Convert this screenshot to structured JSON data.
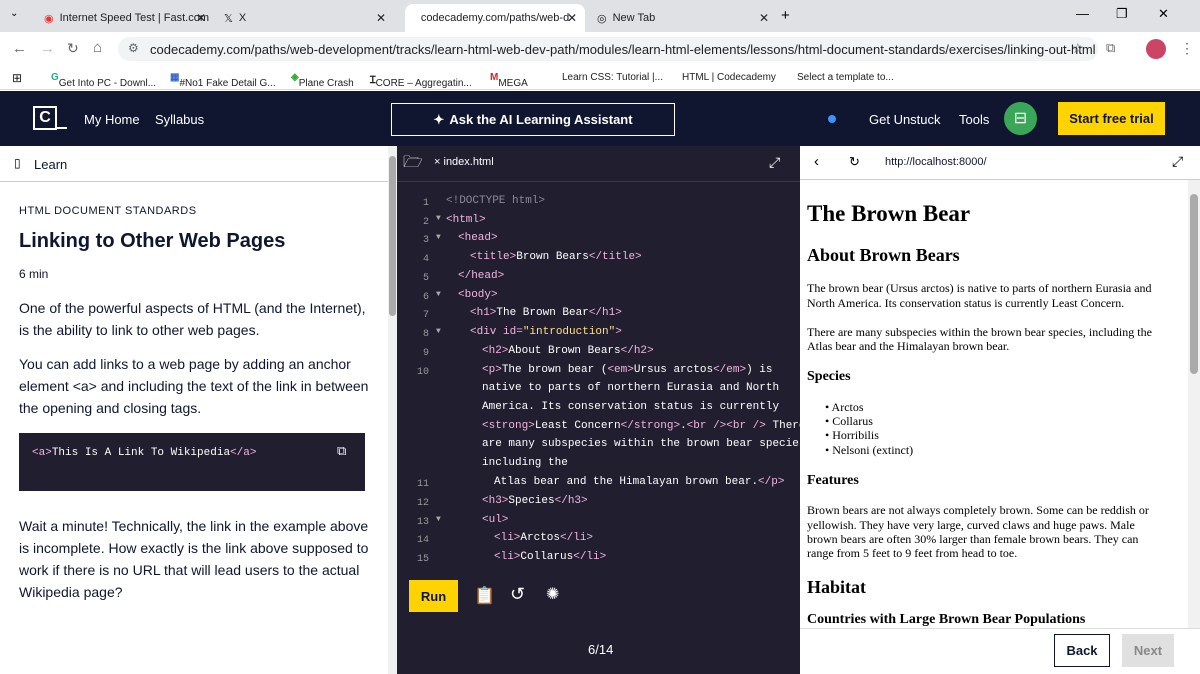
{
  "browser": {
    "tabs": [
      {
        "title": "Internet Speed Test | Fast.com"
      },
      {
        "title": "X"
      },
      {
        "title": "codecademy.com/paths/web-d"
      },
      {
        "title": "New Tab"
      }
    ],
    "url": "codecademy.com/paths/web-development/tracks/learn-html-web-dev-path/modules/learn-html-elements/lessons/html-document-standards/exercises/linking-out-html",
    "bookmarks": [
      "Get Into PC - Downl...",
      "#No1 Fake Detail G...",
      "Plane Crash",
      "CORE – Aggregatin...",
      "MEGA",
      "Learn CSS: Tutorial |...",
      "HTML | Codecademy",
      "Select a template to..."
    ]
  },
  "header": {
    "logo": "C",
    "home": "My Home",
    "syllabus": "Syllabus",
    "assistant": "Ask the AI Learning Assistant",
    "unstuck": "Get Unstuck",
    "tools": "Tools",
    "trial": "Start free trial"
  },
  "lesson": {
    "panel": "Learn",
    "section": "HTML DOCUMENT STANDARDS",
    "title": "Linking to Other Web Pages",
    "time": "6 min",
    "p1a": "One of the powerful aspects of HTML (and the Internet),",
    "p1b": "is the ability to link to other web pages.",
    "p2a": "You can add links to a web page by adding an anchor",
    "p2b": "element <a> and including the text of the link in between",
    "p2c": "the opening and closing tags.",
    "code_open": "<a>",
    "code_text": "This Is A Link To Wikipedia",
    "code_close": "</a>",
    "p3a": "Wait a minute! Technically, the link in the example above",
    "p3b": "is incomplete. How exactly is the link above supposed to",
    "p3c": "work if there is no URL that will lead users to the actual",
    "p3d": "Wikipedia page?"
  },
  "editor": {
    "file": "index.html",
    "run": "Run",
    "progress": "6/14",
    "line_numbers": [
      "1",
      "2",
      "3",
      "4",
      "5",
      "6",
      "7",
      "8",
      "9",
      "10",
      "11",
      "12",
      "13",
      "14",
      "15"
    ]
  },
  "preview": {
    "url": "http://localhost:8000/",
    "h1": "The Brown Bear",
    "h2": "About Brown Bears",
    "p1a": "The brown bear (Ursus arctos) is native to parts of northern Eurasia and",
    "p1b": "North America. Its conservation status is currently Least Concern.",
    "p2a": "There are many subspecies within the brown bear species, including the",
    "p2b": "Atlas bear and the Himalayan brown bear.",
    "h3a": "Species",
    "species": [
      "Arctos",
      "Collarus",
      "Horribilis",
      "Nelsoni (extinct)"
    ],
    "h3b": "Features",
    "p3a": "Brown bears are not always completely brown. Some can be reddish or",
    "p3b": "yellowish. They have very large, curved claws and huge paws. Male",
    "p3c": "brown bears are often 30% larger than female brown bears. They can",
    "p3d": "range from 5 feet to 9 feet from head to toe.",
    "h2b": "Habitat",
    "h3c": "Countries with Large Brown Bear Populations"
  },
  "footer": {
    "back": "Back",
    "next": "Next"
  }
}
